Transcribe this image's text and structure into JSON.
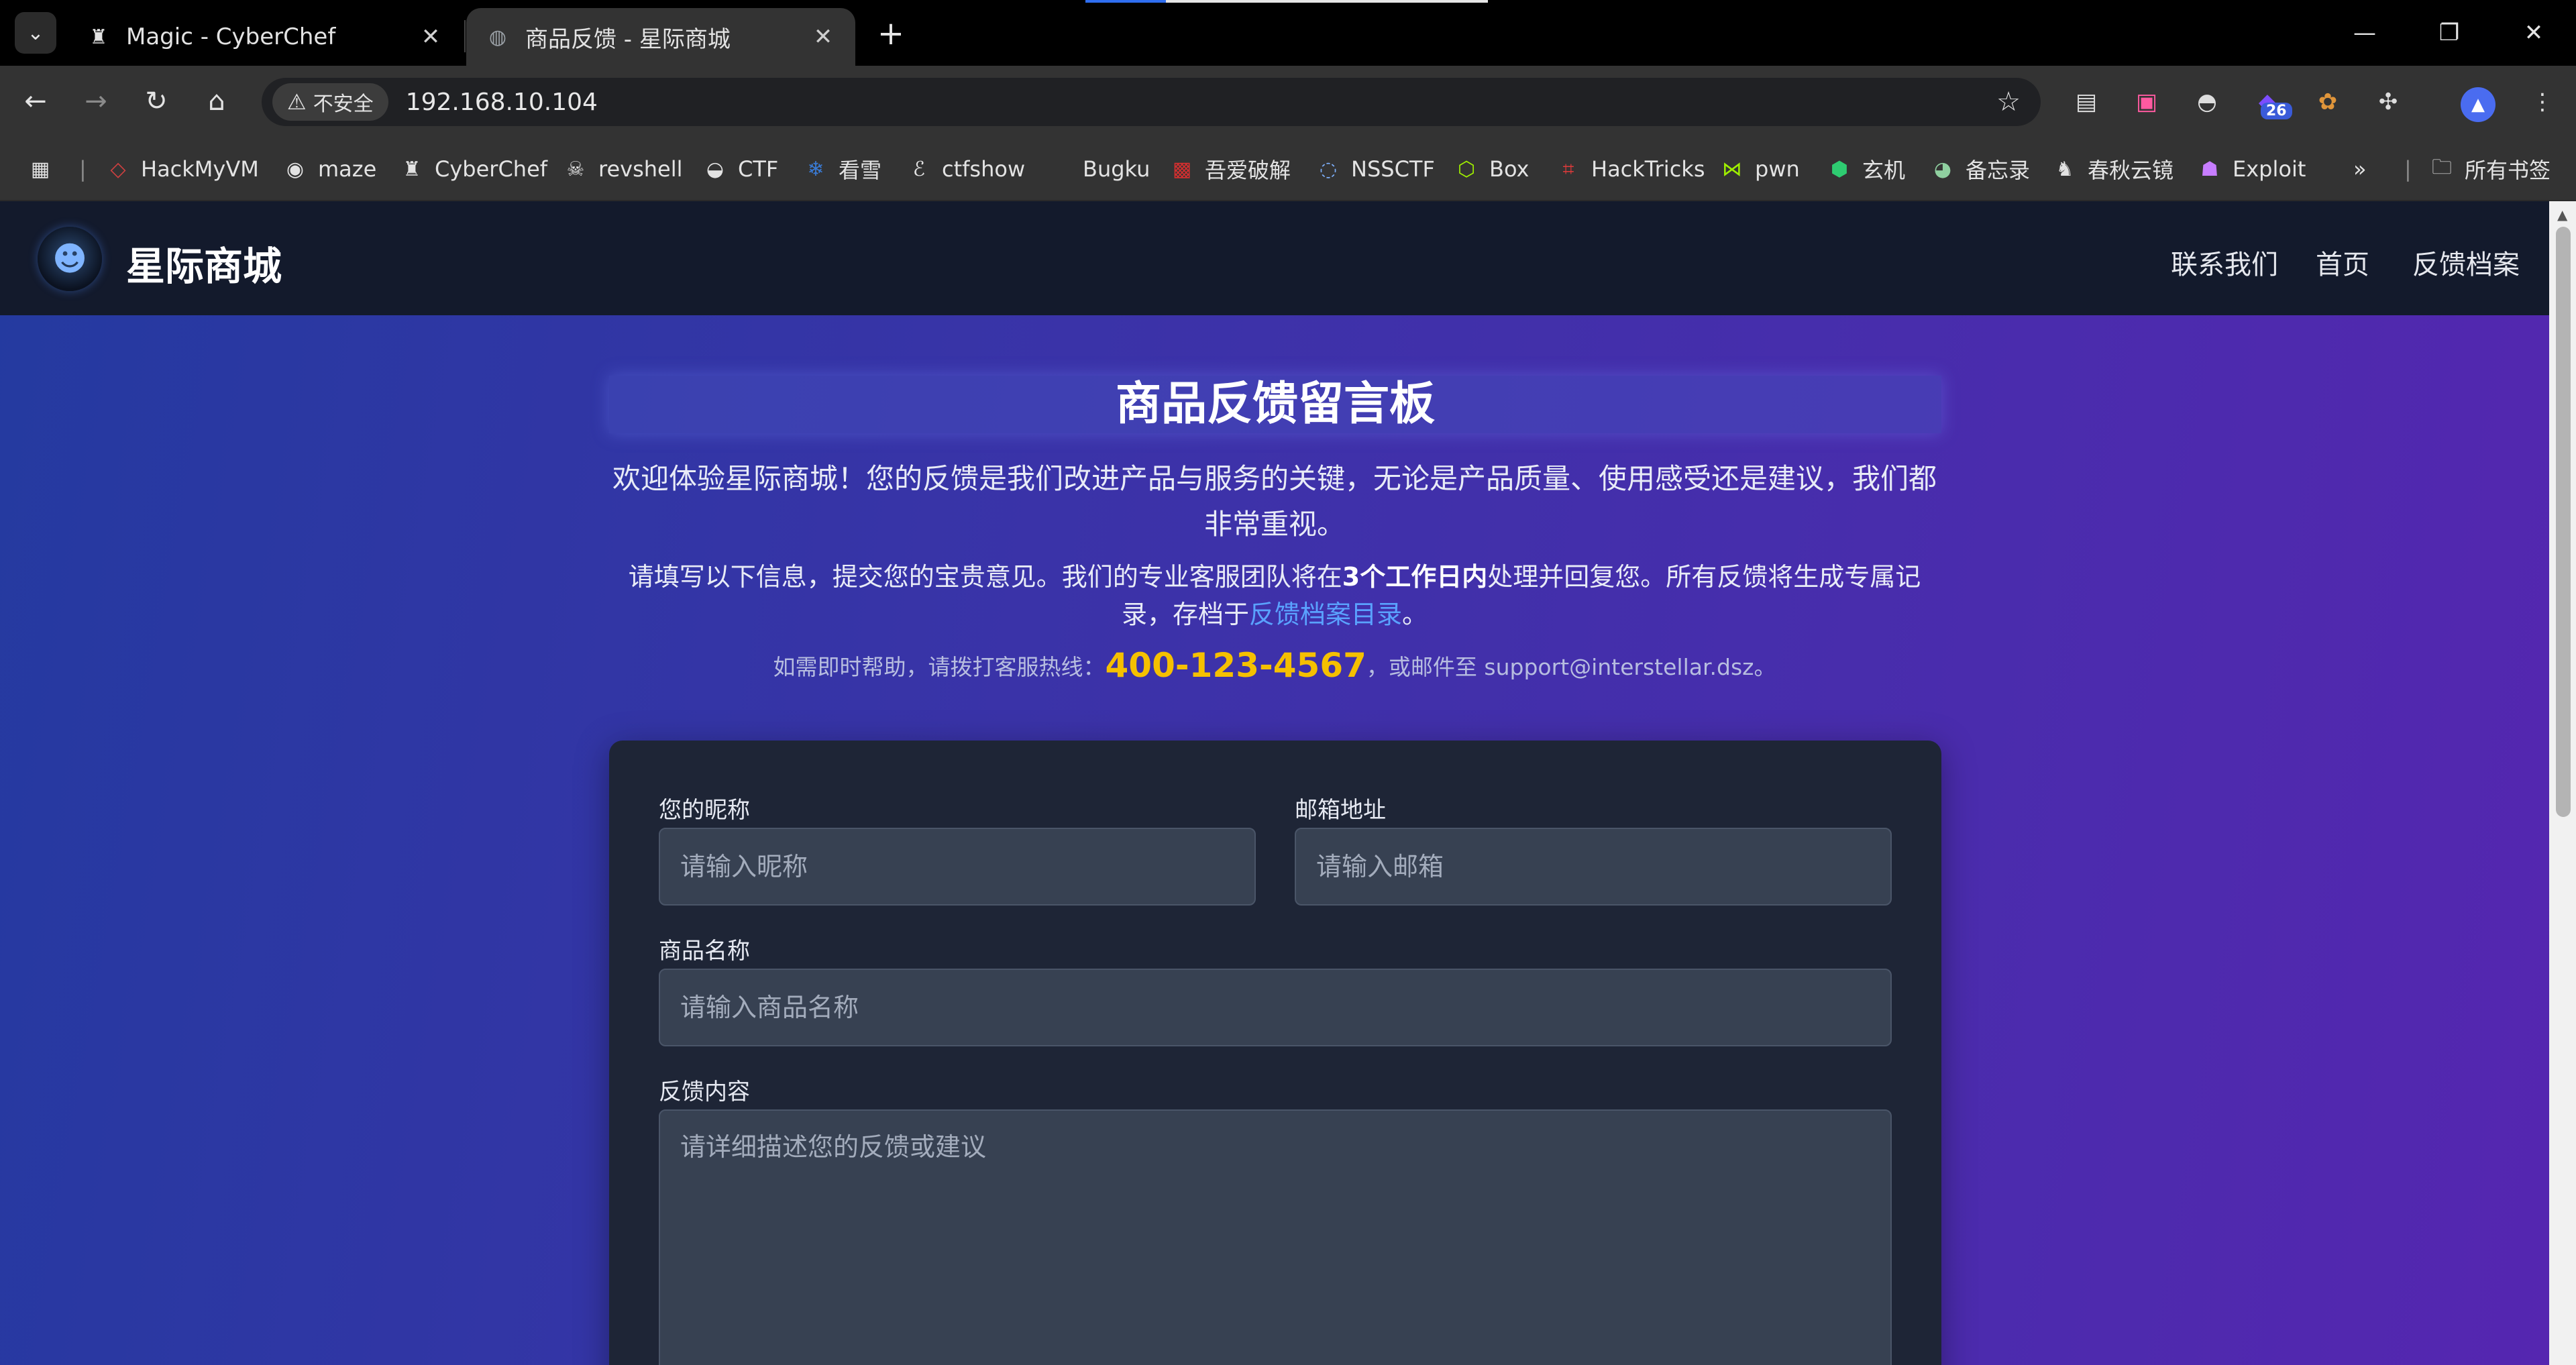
{
  "browser": {
    "tabs": [
      {
        "title": "Magic - CyberChef",
        "icon": "chef-hat-icon",
        "active": false
      },
      {
        "title": "商品反馈 - 星际商城",
        "icon": "globe-icon",
        "active": true
      }
    ],
    "security_label": "不安全",
    "url": "192.168.10.104",
    "extension_badge": "26",
    "bookmarks": [
      {
        "label": "HackMyVM"
      },
      {
        "label": "maze"
      },
      {
        "label": "CyberChef"
      },
      {
        "label": "revshell"
      },
      {
        "label": "CTF"
      },
      {
        "label": "看雪"
      },
      {
        "label": "ctfshow"
      },
      {
        "label": "Bugku"
      },
      {
        "label": "吾爱破解"
      },
      {
        "label": "NSSCTF"
      },
      {
        "label": "Box"
      },
      {
        "label": "HackTricks"
      },
      {
        "label": "pwn"
      },
      {
        "label": "玄机"
      },
      {
        "label": "备忘录"
      },
      {
        "label": "春秋云镜"
      },
      {
        "label": "Exploit"
      }
    ],
    "all_bookmarks_label": "所有书签"
  },
  "site": {
    "brand": "星际商城",
    "nav": [
      "联系我们",
      "首页",
      "反馈档案"
    ]
  },
  "hero": {
    "title": "商品反馈留言板",
    "intro": "欢迎体验星际商城！您的反馈是我们改进产品与服务的关键，无论是产品质量、使用感受还是建议，我们都非常重视。",
    "info_before": "请填写以下信息，提交您的宝贵意见。我们的专业客服团队将在",
    "info_bold": "3个工作日内",
    "info_middle": "处理并回复您。所有反馈将生成专属记录，存档于",
    "info_link": "反馈档案目录",
    "info_end": "。",
    "hotline_before": "如需即时帮助，请拨打客服热线：",
    "hotline_phone": "400-123-4567",
    "hotline_after": "，或邮件至 support@interstellar.dsz。"
  },
  "form": {
    "nickname_label": "您的昵称",
    "nickname_placeholder": "请输入昵称",
    "email_label": "邮箱地址",
    "email_placeholder": "请输入邮箱",
    "product_label": "商品名称",
    "product_placeholder": "请输入商品名称",
    "feedback_label": "反馈内容",
    "feedback_placeholder": "请详细描述您的反馈或建议"
  }
}
